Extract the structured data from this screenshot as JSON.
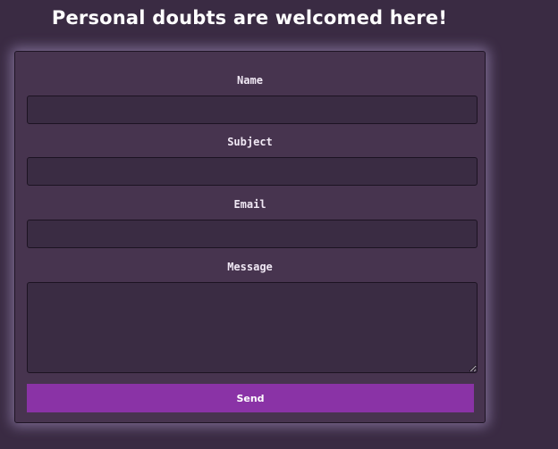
{
  "page": {
    "title": "Personal doubts are welcomed here!"
  },
  "form": {
    "name_label": "Name",
    "name_value": "",
    "subject_label": "Subject",
    "subject_value": "",
    "email_label": "Email",
    "email_value": "",
    "message_label": "Message",
    "message_value": "",
    "send_label": "Send"
  },
  "colors": {
    "page_background": "#3a2b43",
    "card_background": "#47344f",
    "input_background": "#3a2c43",
    "button_accent": "#8a33a6",
    "card_glow": "#c8b4eb"
  }
}
